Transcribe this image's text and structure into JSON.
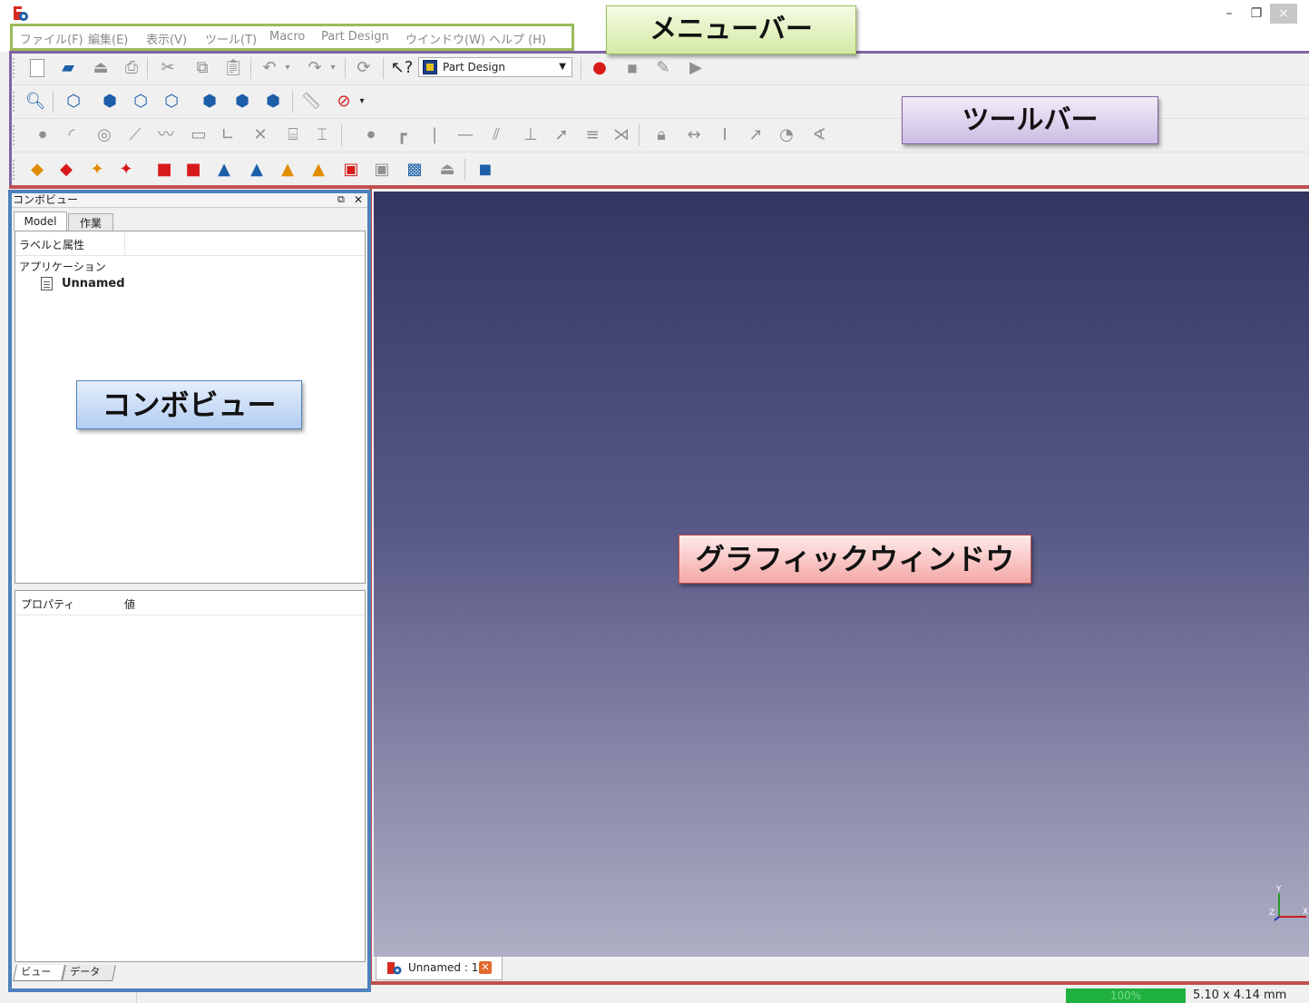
{
  "window": {
    "minimize": "–",
    "restore": "❐",
    "close": "×"
  },
  "menubar": {
    "items": [
      "ファイル(F)",
      "編集(E)",
      "表示(V)",
      "ツール(T)",
      "Macro",
      "Part Design",
      "ウインドウ(W)",
      "ヘルプ (H)"
    ]
  },
  "toolbar": {
    "workbench_selected": "Part Design"
  },
  "combo_view": {
    "title": "コンボビュー",
    "tabs": [
      "Model",
      "作業"
    ],
    "tree_header": "ラベルと属性",
    "tree_root": "アプリケーション",
    "tree_document": "Unnamed",
    "property_header_name": "プロパティ",
    "property_header_value": "値",
    "bottom_tabs": [
      "ビュー",
      "データ"
    ]
  },
  "viewer": {
    "doc_tab_label": "Unnamed : 1",
    "axis_labels": {
      "y": "Y",
      "z": "Z",
      "x": "X"
    }
  },
  "statusbar": {
    "zoom": "100%",
    "dimensions": "5.10 x 4.14 mm"
  },
  "callouts": {
    "menu_bar": "メニューバー",
    "toolbar": "ツールバー",
    "combo_view": "コンボビュー",
    "graphic_window": "グラフィックウィンドウ"
  },
  "colors": {
    "menu_highlight": "#9bbb59",
    "toolbar_highlight": "#8064a2",
    "combo_highlight": "#4f81bd",
    "viewer_highlight": "#c0504d",
    "viewer_gradient_top": "#343560",
    "viewer_gradient_bottom": "#aeaec4",
    "zoom_bar": "#1fb13e"
  }
}
